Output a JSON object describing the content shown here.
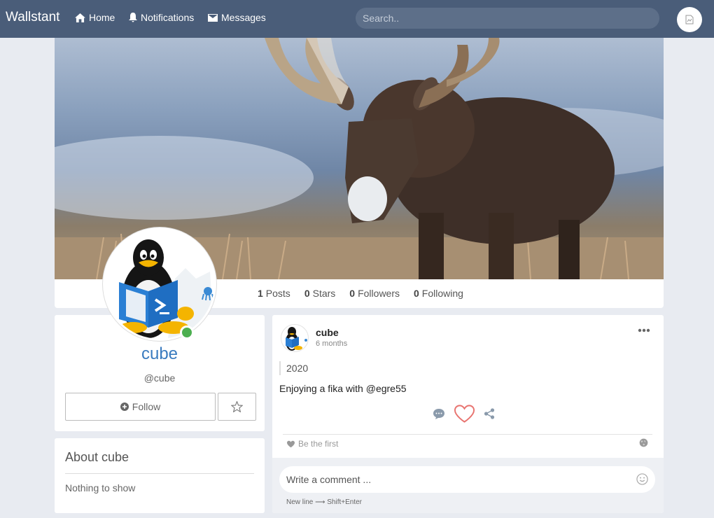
{
  "nav": {
    "brand": "Wallstant",
    "home": "Home",
    "notifications": "Notifications",
    "messages": "Messages",
    "search_placeholder": "Search.."
  },
  "stats": {
    "posts_count": "1",
    "posts_label": "Posts",
    "stars_count": "0",
    "stars_label": "Stars",
    "followers_count": "0",
    "followers_label": "Followers",
    "following_count": "0",
    "following_label": "Following"
  },
  "profile": {
    "name": "cube",
    "handle": "@cube",
    "follow_label": "Follow",
    "status_color": "#4caf50"
  },
  "about": {
    "title": "About cube",
    "text": "Nothing to show"
  },
  "post": {
    "author": "cube",
    "time": "6 months",
    "quote": "2020",
    "text": "Enjoying a fika with @egre55",
    "likes_text": "Be the first",
    "comment_placeholder": "Write a comment ...",
    "hint": "New line ⟶ Shift+Enter"
  },
  "colors": {
    "navbar": "#4a5d79",
    "accent": "#3a7bbf",
    "heart": "#e8736f"
  }
}
